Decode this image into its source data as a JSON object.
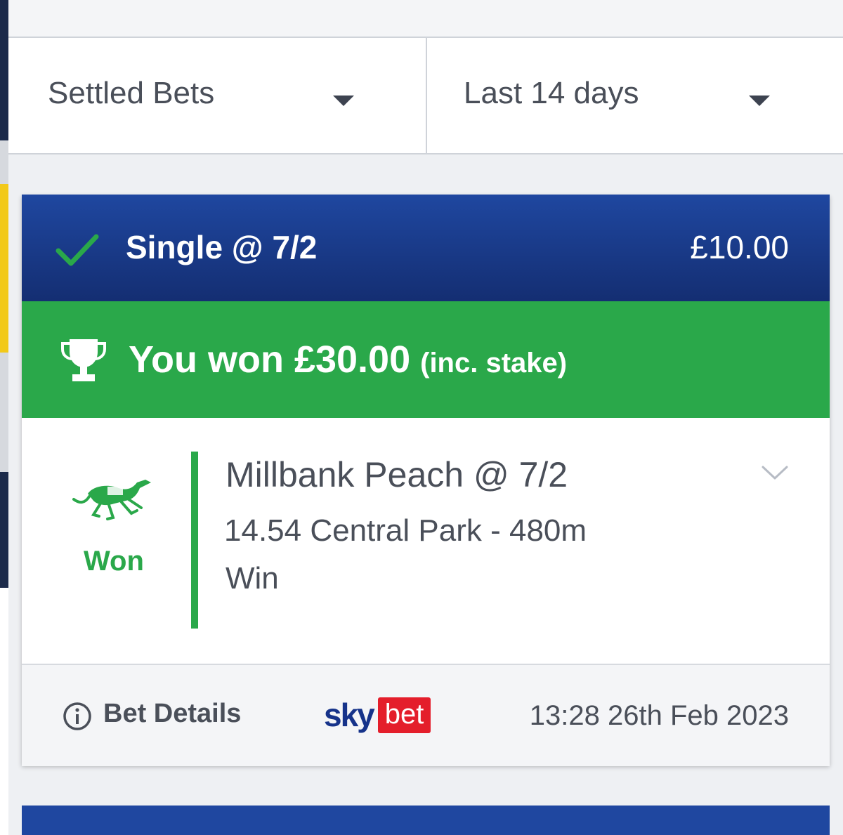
{
  "filters": {
    "bet_status": "Settled Bets",
    "period": "Last 14 days"
  },
  "bet": {
    "type": "Single @ 7/2",
    "stake": "£10.00",
    "win_message": "You won £30.00",
    "win_note": "(inc. stake)",
    "selection": {
      "result": "Won",
      "name": "Millbank Peach @ 7/2",
      "event": "14.54 Central Park - 480m",
      "market": "Win"
    },
    "details_label": "Bet Details",
    "placed_at": "13:28 26th Feb 2023"
  },
  "brand": {
    "logo_sky": "sky",
    "logo_bet": "bet"
  },
  "colors": {
    "header_blue": "#1f47a0",
    "win_green": "#2aa84a",
    "brand_red": "#e41e2b",
    "text_grey": "#4a4f59"
  },
  "icons": {
    "status": "checkmark-icon",
    "win": "trophy-icon",
    "sport": "greyhound-icon",
    "expand": "chevron-down-icon",
    "info": "info-icon",
    "dropdown": "caret-down-icon"
  }
}
